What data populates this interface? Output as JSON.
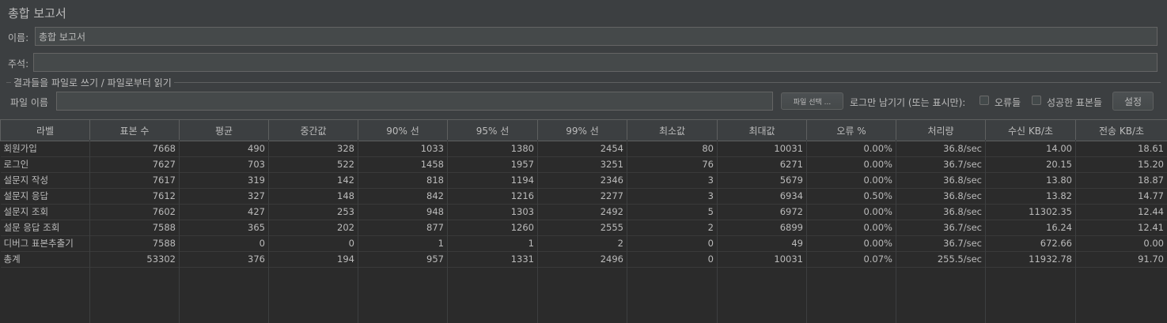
{
  "title": "총합 보고서",
  "name_label": "이름:",
  "name_value": "총합 보고서",
  "comment_label": "주석:",
  "comment_value": "",
  "file_group_title": "결과들을 파일로 쓰기 / 파일로부터 읽기",
  "filename_label": "파일 이름",
  "filename_value": "",
  "browse_button": "파일 선택 ...",
  "log_only_label": "로그만 남기기 (또는 표시만):",
  "errors_label": "오류들",
  "success_label": "성공한 표본들",
  "configure_button": "설정",
  "table": {
    "headers": [
      "라벨",
      "표본 수",
      "평균",
      "중간값",
      "90% 선",
      "95% 선",
      "99% 선",
      "최소값",
      "최대값",
      "오류 %",
      "처리량",
      "수신 KB/초",
      "전송 KB/초"
    ],
    "rows": [
      [
        "회원가입",
        "7668",
        "490",
        "328",
        "1033",
        "1380",
        "2454",
        "80",
        "10031",
        "0.00%",
        "36.8/sec",
        "14.00",
        "18.61"
      ],
      [
        "로그인",
        "7627",
        "703",
        "522",
        "1458",
        "1957",
        "3251",
        "76",
        "6271",
        "0.00%",
        "36.7/sec",
        "20.15",
        "15.20"
      ],
      [
        "설문지 작성",
        "7617",
        "319",
        "142",
        "818",
        "1194",
        "2346",
        "3",
        "5679",
        "0.00%",
        "36.8/sec",
        "13.80",
        "18.87"
      ],
      [
        "설문지 응답",
        "7612",
        "327",
        "148",
        "842",
        "1216",
        "2277",
        "3",
        "6934",
        "0.50%",
        "36.8/sec",
        "13.82",
        "14.77"
      ],
      [
        "설문지 조회",
        "7602",
        "427",
        "253",
        "948",
        "1303",
        "2492",
        "5",
        "6972",
        "0.00%",
        "36.8/sec",
        "11302.35",
        "12.44"
      ],
      [
        "설문 응답 조회",
        "7588",
        "365",
        "202",
        "877",
        "1260",
        "2555",
        "2",
        "6899",
        "0.00%",
        "36.7/sec",
        "16.24",
        "12.41"
      ],
      [
        "디버그 표본추출기",
        "7588",
        "0",
        "0",
        "1",
        "1",
        "2",
        "0",
        "49",
        "0.00%",
        "36.7/sec",
        "672.66",
        "0.00"
      ],
      [
        "총계",
        "53302",
        "376",
        "194",
        "957",
        "1331",
        "2496",
        "0",
        "10031",
        "0.07%",
        "255.5/sec",
        "11932.78",
        "91.70"
      ]
    ]
  }
}
